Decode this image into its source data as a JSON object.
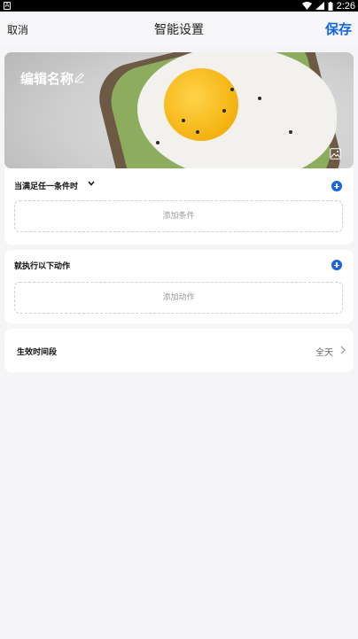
{
  "status_bar": {
    "time": "2:26",
    "left_icon": "android-notification-icon"
  },
  "nav": {
    "cancel": "取消",
    "title": "智能设置",
    "save": "保存"
  },
  "hero": {
    "name": "编辑名称"
  },
  "condition": {
    "title": "当满足任一条件时",
    "add_placeholder": "添加条件"
  },
  "action": {
    "title": "就执行以下动作",
    "add_placeholder": "添加动作"
  },
  "period": {
    "label": "生效时间段",
    "value": "全天"
  },
  "colors": {
    "accent": "#1166e6",
    "background": "#f5f5f7"
  }
}
